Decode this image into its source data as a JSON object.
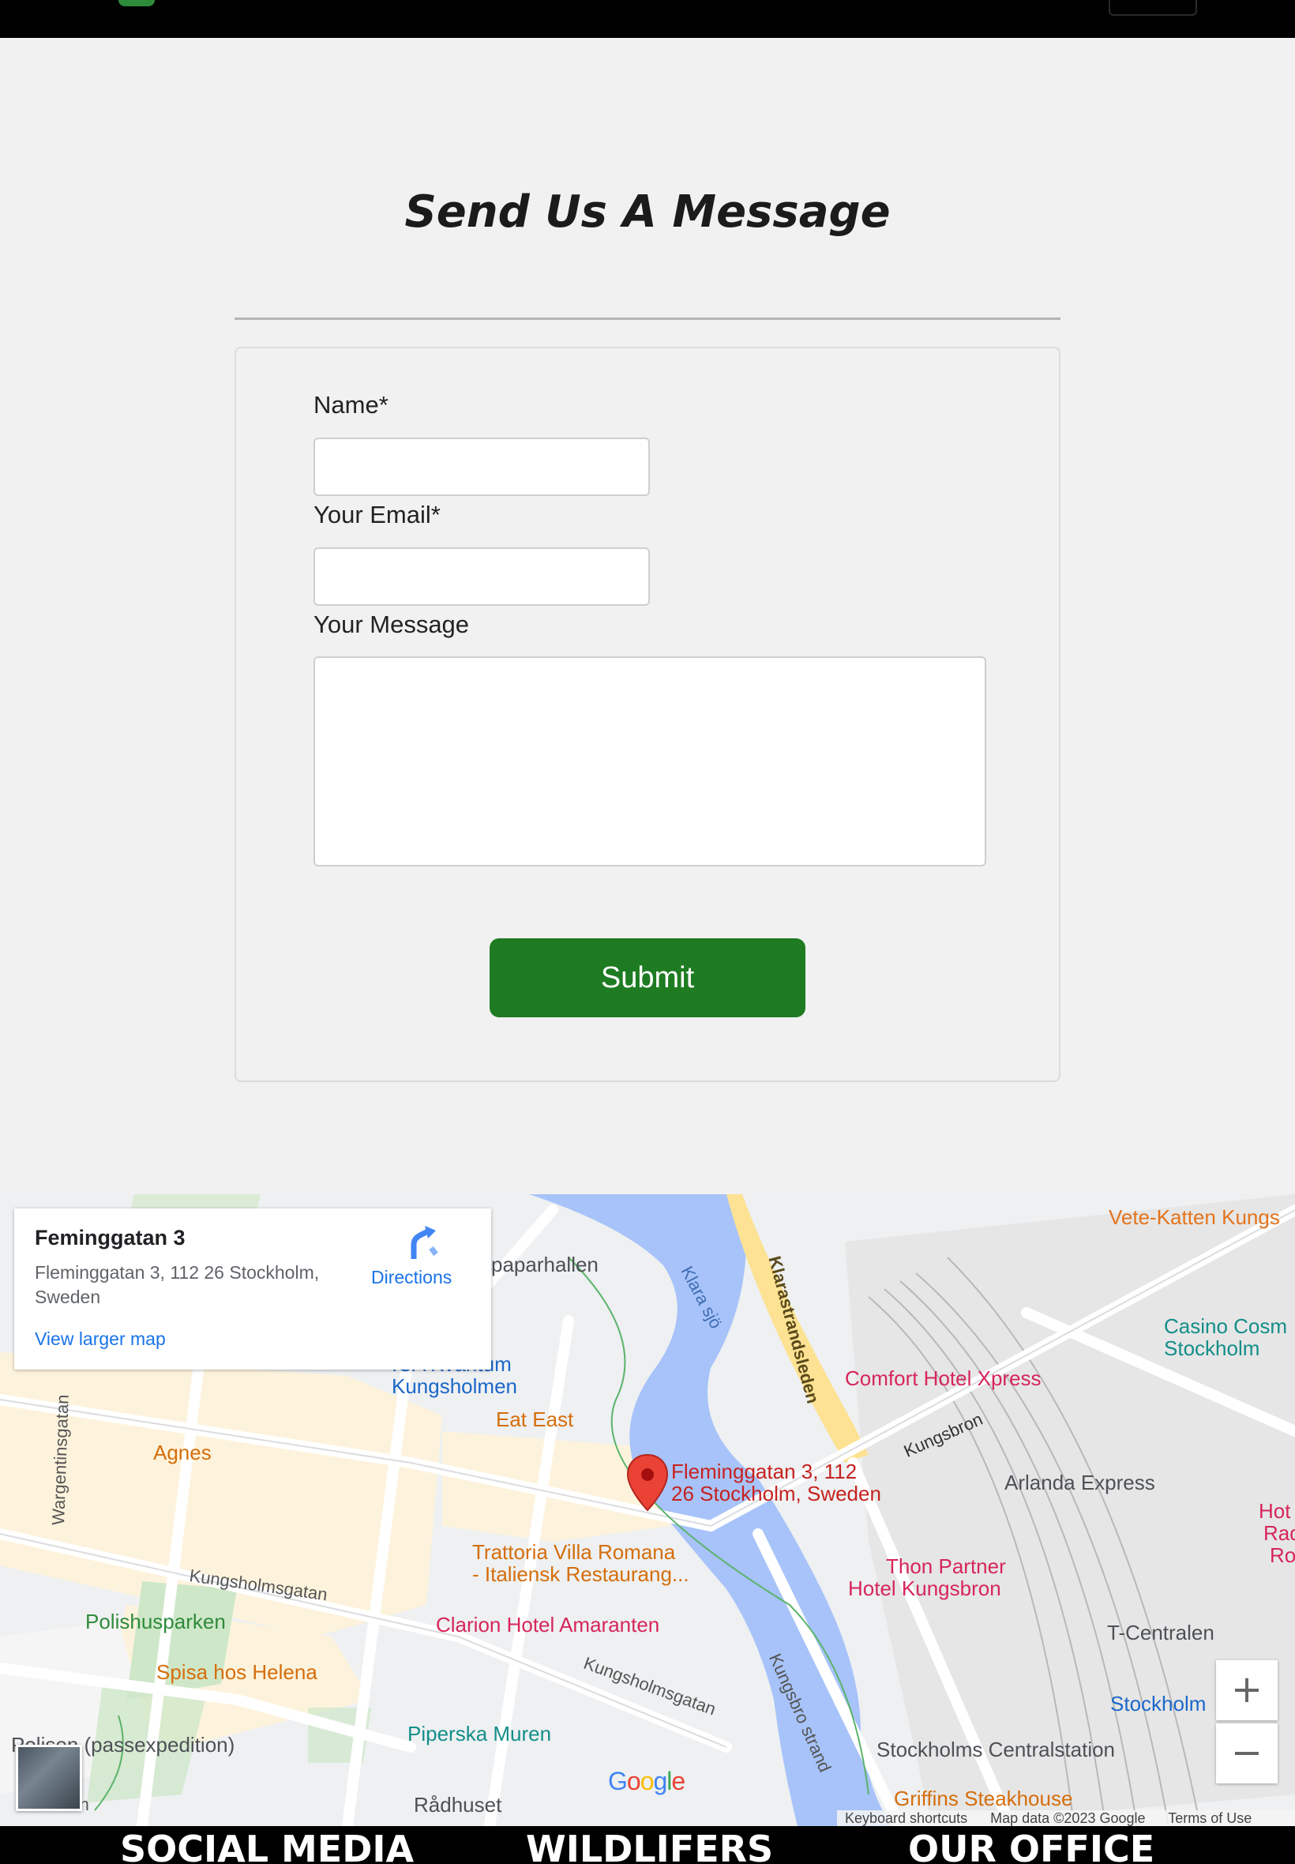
{
  "contact": {
    "heading": "Send Us A Message",
    "name_label": "Name*",
    "email_label": "Your Email*",
    "message_label": "Your Message",
    "name_value": "",
    "email_value": "",
    "message_value": "",
    "submit_label": "Submit"
  },
  "map": {
    "place_title": "Feminggatan 3",
    "place_address": "Fleminggatan 3, 112 26 Stockholm, Sweden",
    "view_larger": "View larger map",
    "directions": "Directions",
    "pin_label_line1": "Fleminggatan 3, 112",
    "pin_label_line2": "26 Stockholm, Sweden",
    "zoom_in": "+",
    "zoom_out": "−",
    "google_logo": "Google",
    "attribution": {
      "keyboard": "Keyboard shortcuts",
      "map_data": "Map data ©2023 Google",
      "terms": "Terms of Use"
    },
    "pois": {
      "vete_katten": "Vete-Katten Kungs",
      "casino_1": "Casino Cosm",
      "casino_2": "Stockholm",
      "comfort_hotel": "Comfort Hotel Xpress",
      "klara_sjo": "Klara sjö",
      "klarastrandsleden": "Klarastrandsleden",
      "kungsbron": "Kungsbron",
      "arlanda_express": "Arlanda Express",
      "hot_1": "Hot",
      "hot_2": "Rad",
      "hot_3": "Ro",
      "paparhallen": "paparhallen",
      "ica_1": "ICA Kvantum",
      "ica_2": "Kungsholmen",
      "eat_east": "Eat East",
      "agnes": "Agnes",
      "trattoria_1": "Trattoria Villa Romana",
      "trattoria_2": "- Italiensk Restaurang...",
      "thon_1": "Thon Partner",
      "thon_2": "Hotel Kungsbron",
      "clarion": "Clarion Hotel Amaranten",
      "polishusparken": "Polishusparken",
      "spisa": "Spisa hos Helena",
      "kungsholmsgatan_1": "Kungsholmsgatan",
      "kungsholmsgatan_2": "Kungsholmsgatan",
      "wargentinsgatan": "Wargentinsgatan",
      "kungsbro_strand": "Kungsbro strand",
      "t_centralen": "T-Centralen",
      "stockholm_c": "Stockholm",
      "centralstation": "Stockholms Centralstation",
      "polisen": "Polisen (passexpedition)",
      "piperska": "Piperska Muren",
      "radhuset": "Rådhuset",
      "griffins": "Griffins Steakhouse",
      "gatan": "atan"
    }
  },
  "footer": {
    "col1": "SOCIAL MEDIA",
    "col2": "WILDLIFERS",
    "col3": "OUR OFFICE"
  }
}
